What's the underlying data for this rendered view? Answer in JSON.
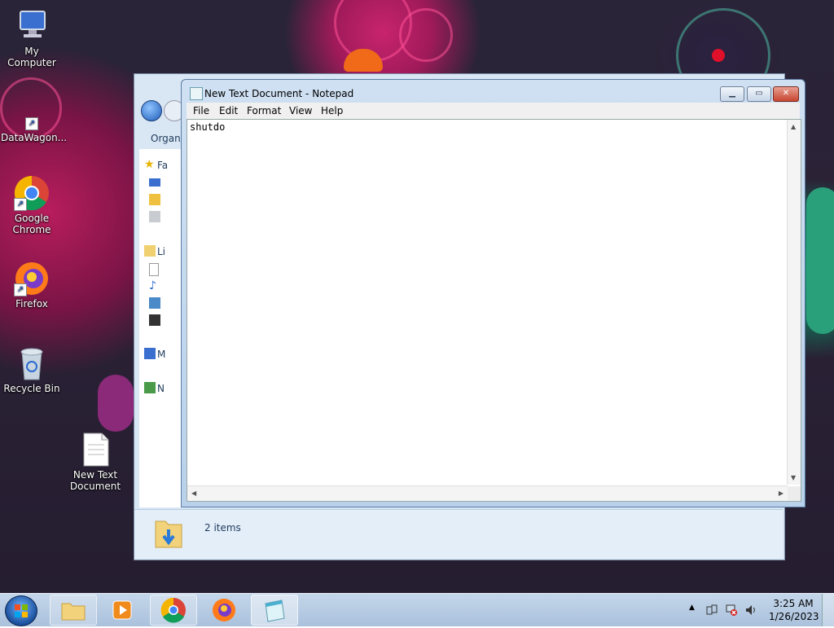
{
  "desktop_icons": [
    {
      "label": "My Computer",
      "icon": "computer-icon"
    },
    {
      "label": "DataWagon...",
      "icon": "datawagon-shortcut-icon"
    },
    {
      "label": "Google Chrome",
      "icon": "chrome-icon"
    },
    {
      "label": "Firefox",
      "icon": "firefox-icon"
    },
    {
      "label": "Recycle Bin",
      "icon": "recycle-bin-icon"
    },
    {
      "label": "New Text Document",
      "icon": "text-document-icon"
    }
  ],
  "explorer": {
    "organize_label": "Organ",
    "nav_items": [
      "Fa",
      "Li",
      "M",
      "N"
    ],
    "status_text": "2 items"
  },
  "notepad": {
    "title": "New Text Document - Notepad",
    "menu": [
      "File",
      "Edit",
      "Format",
      "View",
      "Help"
    ],
    "content": "shutdo"
  },
  "taskbar": {
    "time": "3:25 AM",
    "date": "1/26/2023",
    "pinned": [
      "windows-explorer",
      "media-player",
      "google-chrome",
      "firefox",
      "notepad"
    ]
  },
  "colors": {
    "taskbar": "#b6cbe3",
    "titlebar": "#c6dbf0",
    "desktop": "#2a2438"
  }
}
